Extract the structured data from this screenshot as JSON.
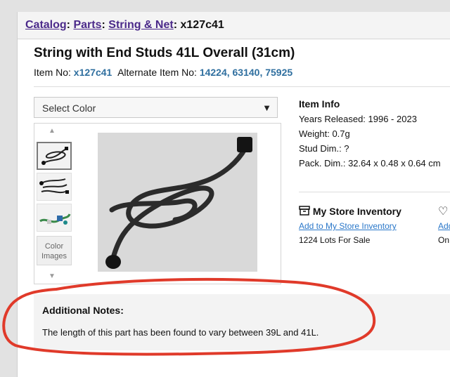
{
  "breadcrumb": {
    "items": [
      "Catalog",
      "Parts",
      "String & Net"
    ],
    "current": "x127c41"
  },
  "item": {
    "title": "String with End Studs 41L Overall (31cm)",
    "item_no_label": "Item No:",
    "item_no": "x127c41",
    "alt_label": "Alternate Item No:",
    "alt_nos": "14224, 63140, 75925"
  },
  "color_select": {
    "label": "Select Color"
  },
  "thumbs": {
    "color_images_label": "Color Images"
  },
  "item_info": {
    "heading": "Item Info",
    "years": "Years Released: 1996 - 2023",
    "weight": "Weight: 0.7g",
    "stud": "Stud Dim.: ?",
    "pack": "Pack. Dim.: 32.64 x 0.48 x 0.64 cm"
  },
  "store": {
    "heading": "My Store Inventory",
    "add_link": "Add to My Store Inventory",
    "lots": "1224 Lots For Sale",
    "cut_link": "Add",
    "cut_text": "On"
  },
  "notes": {
    "heading": "Additional Notes:",
    "text": "The length of this part has been found to vary between 39L and 41L."
  },
  "colors": {
    "link_purple": "#4b2a8a",
    "link_blue": "#2a77c9",
    "annotation_red": "#e03a2a"
  }
}
